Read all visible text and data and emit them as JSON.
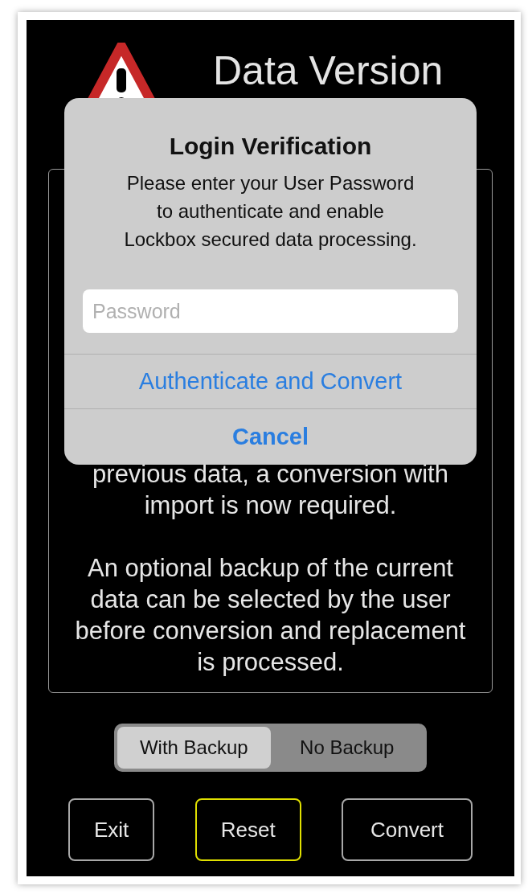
{
  "header": {
    "title": "Data Version"
  },
  "notice": {
    "paragraphs": [
      "previous data, a conversion with\nimport is now required.",
      "An optional backup of the current\ndata can be selected by the user\nbefore conversion and replacement\nis processed."
    ]
  },
  "backup_options": [
    {
      "label": "With Backup",
      "selected": true
    },
    {
      "label": "No Backup",
      "selected": false
    }
  ],
  "buttons": [
    {
      "label": "Exit",
      "focused": false
    },
    {
      "label": "Reset",
      "focused": true
    },
    {
      "label": "Convert",
      "focused": false
    }
  ],
  "dialog": {
    "title": "Login Verification",
    "message": "Please enter your User Password\nto authenticate and enable\nLockbox secured data processing.",
    "password": {
      "placeholder": "Password"
    },
    "actions": [
      {
        "label": "Authenticate and Convert",
        "kind": "default"
      },
      {
        "label": "Cancel",
        "kind": "cancel"
      }
    ]
  }
}
